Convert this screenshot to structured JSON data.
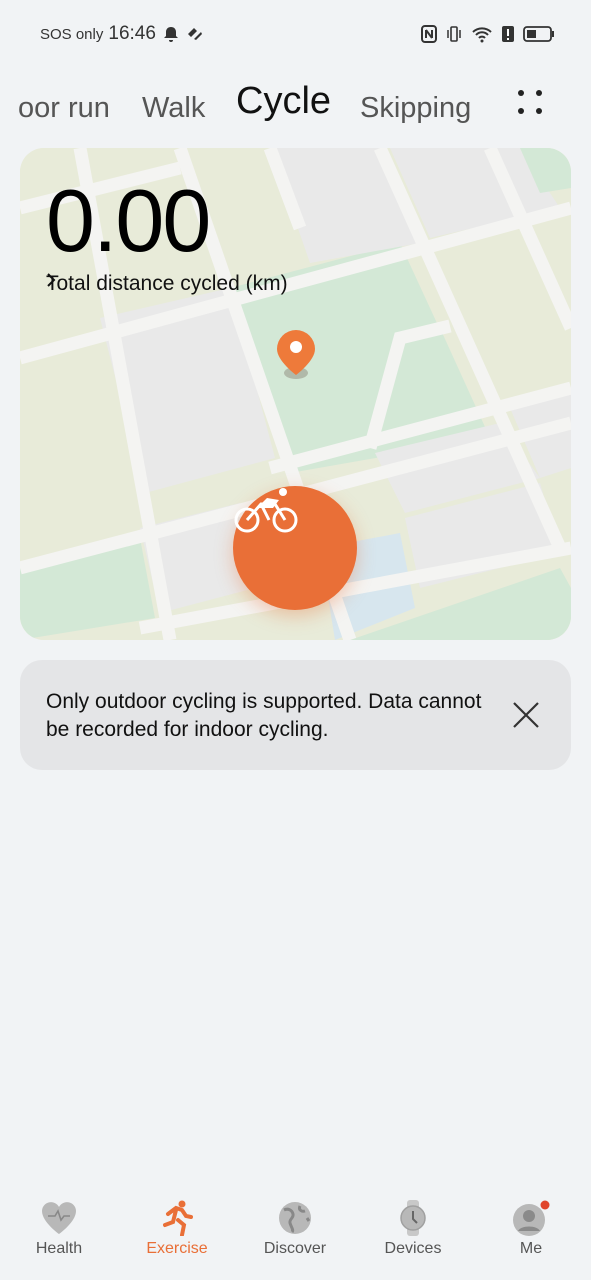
{
  "status_bar": {
    "carrier": "SOS only",
    "time": "16:46"
  },
  "tabs": [
    {
      "label": "oor run"
    },
    {
      "label": "Walk"
    },
    {
      "label": "Cycle",
      "active": true
    },
    {
      "label": "Skipping"
    }
  ],
  "more_icon": "more-dots-icon",
  "summary": {
    "distance": "0.00",
    "label": "Total distance cycled (km)"
  },
  "start_button_icon": "cycling-icon",
  "notice": {
    "text": "Only outdoor cycling is supported. Data cannot be recorded for indoor cycling."
  },
  "bottom_nav": [
    {
      "label": "Health",
      "icon": "heart-icon"
    },
    {
      "label": "Exercise",
      "icon": "running-icon",
      "active": true
    },
    {
      "label": "Discover",
      "icon": "globe-icon"
    },
    {
      "label": "Devices",
      "icon": "watch-icon"
    },
    {
      "label": "Me",
      "icon": "avatar-icon",
      "badge": true
    }
  ],
  "colors": {
    "accent": "#e96f37",
    "background": "#f1f3f5"
  }
}
